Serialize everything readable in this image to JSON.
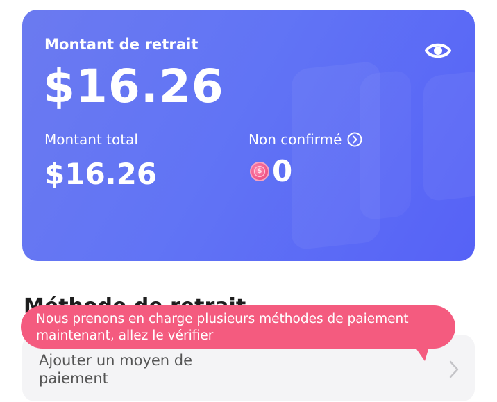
{
  "card": {
    "withdraw_label": "Montant de retrait",
    "withdraw_amount": "$16.26",
    "total_label": "Montant total",
    "total_amount": "$16.26",
    "unconfirmed_label": "Non confirmé",
    "unconfirmed_value": "0",
    "gradient_start": "#6b7af0",
    "gradient_end": "#5662f6",
    "eye_icon": "eye-icon",
    "coin_icon": "dollar-coin-icon"
  },
  "section": {
    "title": "Méthode de retrait"
  },
  "tooltip": {
    "text": "Nous prenons en charge plusieurs méthodes de paiement maintenant, allez le vérifier",
    "color": "#f45b7f"
  },
  "payment": {
    "add_label": "Ajouter un moyen de paiement"
  }
}
